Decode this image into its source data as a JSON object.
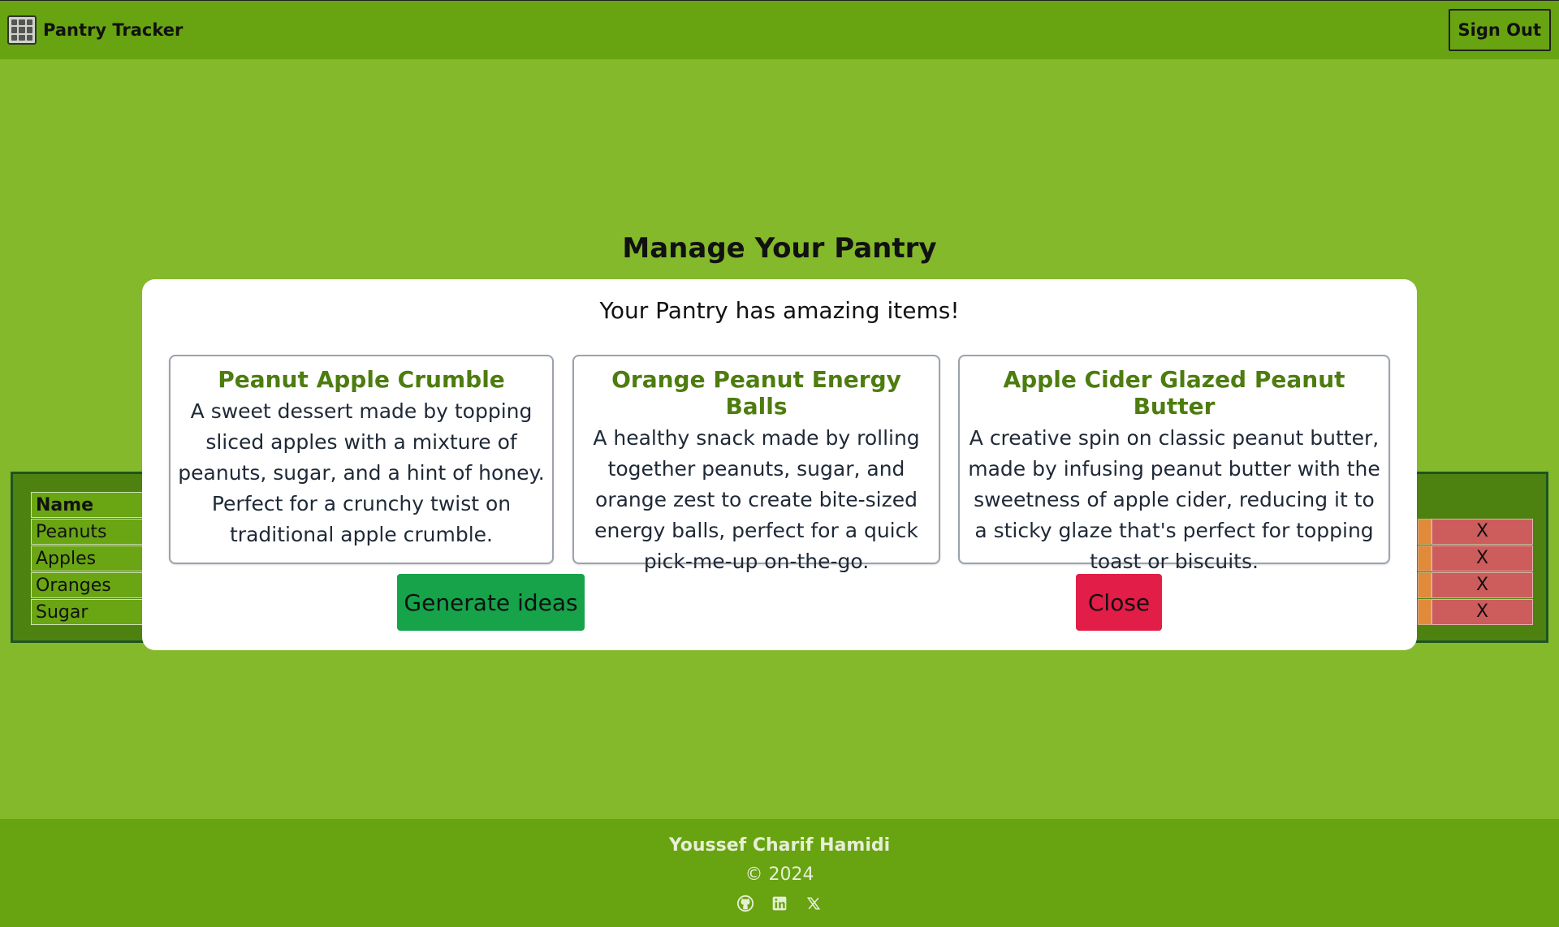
{
  "header": {
    "logo_icon": "pantry-shelf-icon",
    "title": "Pantry Tracker",
    "sign_out_label": "Sign Out"
  },
  "page": {
    "heading": "Manage Your Pantry"
  },
  "table": {
    "name_header": "Name",
    "rows": [
      {
        "name": "Peanuts",
        "delete_label": "X"
      },
      {
        "name": "Apples",
        "delete_label": "X"
      },
      {
        "name": "Oranges",
        "delete_label": "X"
      },
      {
        "name": "Sugar",
        "delete_label": "X"
      }
    ]
  },
  "modal": {
    "title": "Your Pantry has amazing items!",
    "cards": [
      {
        "title": "Peanut Apple Crumble",
        "description": "A sweet dessert made by topping sliced apples with a mixture of peanuts, sugar, and a hint of honey. Perfect for a crunchy twist on traditional apple crumble."
      },
      {
        "title": "Orange Peanut Energy Balls",
        "description": "A healthy snack made by rolling together peanuts, sugar, and orange zest to create bite-sized energy balls, perfect for a quick pick-me-up on-the-go."
      },
      {
        "title": "Apple Cider Glazed Peanut Butter",
        "description": "A creative spin on classic peanut butter, made by infusing peanut butter with the sweetness of apple cider, reducing it to a sticky glaze that's perfect for topping toast or biscuits."
      }
    ],
    "generate_label": "Generate ideas",
    "close_label": "Close"
  },
  "footer": {
    "name": "Youssef Charif Hamidi",
    "copyright": "© 2024",
    "social_icons": [
      "github-icon",
      "linkedin-icon",
      "x-icon"
    ]
  },
  "colors": {
    "background": "#84b92b",
    "header": "#68a311",
    "table_bg": "#4d8210",
    "card_title": "#4d7c0f",
    "generate_button": "#16a34a",
    "close_button": "#e11d48",
    "delete_cell": "#cd5c5c"
  }
}
